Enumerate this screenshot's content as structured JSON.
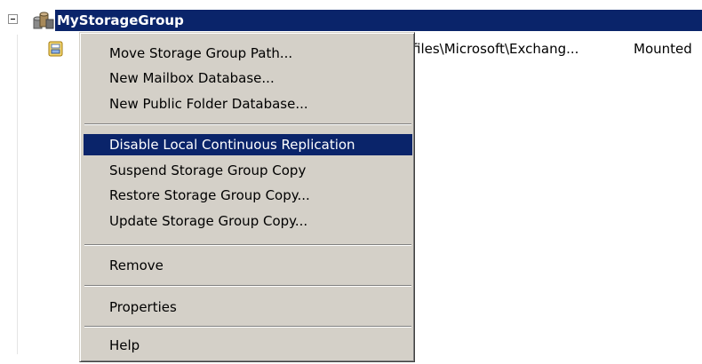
{
  "tree": {
    "storage_group": {
      "label": "MyStorageGroup",
      "icon": "storage-group-icon"
    },
    "database_row": {
      "icon": "mailbox-database-icon",
      "path": "files\\Microsoft\\Exchang...",
      "status": "Mounted"
    }
  },
  "context_menu": {
    "items": [
      "Move Storage Group Path...",
      "New Mailbox Database...",
      "New Public Folder Database...",
      "Disable Local Continuous Replication",
      "Suspend Storage Group Copy",
      "Restore Storage Group Copy...",
      "Update Storage Group Copy...",
      "Remove",
      "Properties",
      "Help"
    ],
    "highlighted_item": "Disable Local Continuous Replication"
  },
  "colors": {
    "selection": "#0a246a",
    "menu_face": "#d4d0c8"
  }
}
